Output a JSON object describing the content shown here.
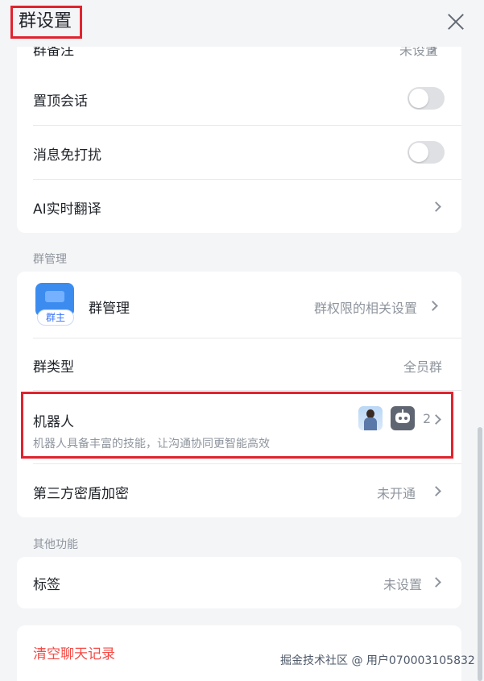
{
  "header": {
    "title": "群设置"
  },
  "group_settings": {
    "partial_row": {
      "label": "群备注",
      "value": "未设置"
    },
    "pin_chat": {
      "label": "置顶会话"
    },
    "mute": {
      "label": "消息免打扰"
    },
    "ai_translate": {
      "label": "AI实时翻译"
    }
  },
  "group_management": {
    "section_title": "群管理",
    "manage": {
      "label": "群管理",
      "badge": "群主",
      "value": "群权限的相关设置"
    },
    "group_type": {
      "label": "群类型",
      "value": "全员群"
    },
    "robots": {
      "label": "机器人",
      "description": "机器人具备丰富的技能，让沟通协同更智能高效",
      "count": "2"
    },
    "encryption": {
      "label": "第三方密盾加密",
      "value": "未开通"
    }
  },
  "other": {
    "section_title": "其他功能",
    "tags": {
      "label": "标签",
      "value": "未设置"
    }
  },
  "danger": {
    "clear_history": "清空聊天记录"
  },
  "watermark": "掘金技术社区 @ 用户070003105832"
}
